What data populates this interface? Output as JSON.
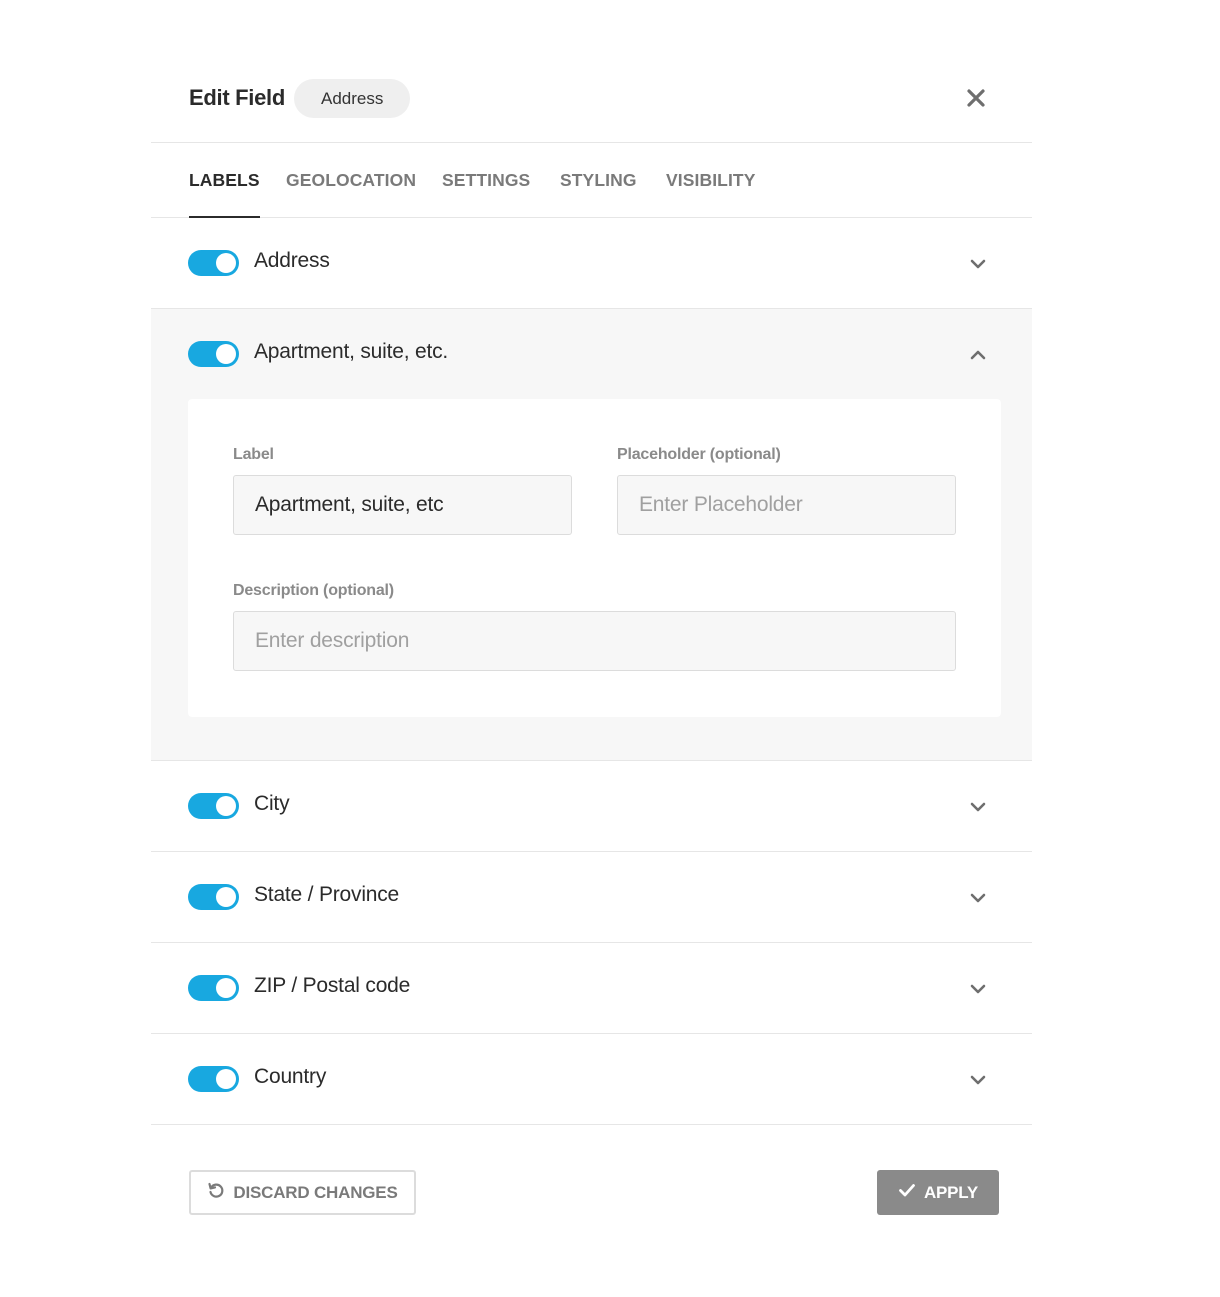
{
  "header": {
    "title": "Edit Field",
    "badge": "Address"
  },
  "tabs": [
    {
      "label": "LABELS",
      "active": true
    },
    {
      "label": "GEOLOCATION",
      "active": false
    },
    {
      "label": "SETTINGS",
      "active": false
    },
    {
      "label": "STYLING",
      "active": false
    },
    {
      "label": "VISIBILITY",
      "active": false
    }
  ],
  "fields": [
    {
      "label": "Address",
      "enabled": true,
      "expanded": false
    },
    {
      "label": "Apartment, suite, etc.",
      "enabled": true,
      "expanded": true
    },
    {
      "label": "City",
      "enabled": true,
      "expanded": false
    },
    {
      "label": "State / Province",
      "enabled": true,
      "expanded": false
    },
    {
      "label": "ZIP / Postal code",
      "enabled": true,
      "expanded": false
    },
    {
      "label": "Country",
      "enabled": true,
      "expanded": false
    }
  ],
  "editor": {
    "label_title": "Label",
    "label_value": "Apartment, suite, etc",
    "placeholder_title": "Placeholder (optional)",
    "placeholder_hint": "Enter Placeholder",
    "description_title": "Description (optional)",
    "description_hint": "Enter description"
  },
  "footer": {
    "discard_label": "DISCARD CHANGES",
    "apply_label": "APPLY"
  },
  "colors": {
    "toggle_on": "#18a8e0",
    "apply_bg": "#8a8a8a",
    "expanded_bg": "#f7f7f7"
  },
  "icons": {
    "close": "close-icon",
    "expand": "chevron-down-icon",
    "collapse": "chevron-up-icon",
    "discard": "undo-icon",
    "apply": "check-icon"
  }
}
